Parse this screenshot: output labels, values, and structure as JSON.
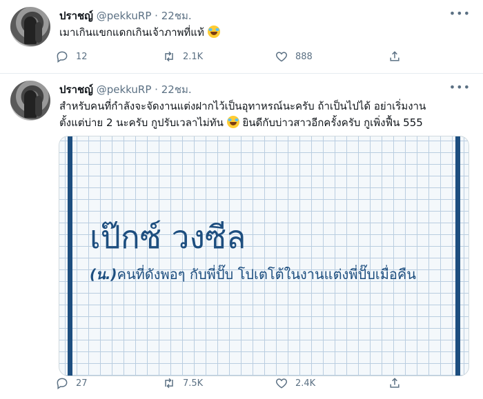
{
  "tweets": [
    {
      "name": "ปราชญ์",
      "handle": "@pekkuRP",
      "separator": "·",
      "time": "22ชม.",
      "text": "เมาเกินแขกแดกเกินเจ้าภาพที่แท้",
      "emoji": "face-with-tears-of-joy",
      "replies": "12",
      "retweets": "2.1K",
      "likes": "888"
    },
    {
      "name": "ปราชญ์",
      "handle": "@pekkuRP",
      "separator": "·",
      "time": "22ชม.",
      "text_line1": "สำหรับคนที่กำลังจะจัดงานแต่งฝากไว้เป็นอุทาหรณ์นะครับ ถ้าเป็นไปได้ อย่าเริ่มงาน",
      "text_line2a": "ตั้งแต่บ่าย 2 นะครับ กูปรับเวลาไม่ทัน",
      "text_line2b": " ยินดีกับบ่าวสาวอีกครั้งครับ กูเพิ่งฟื้น 555",
      "emoji": "face-with-tears-of-joy",
      "card": {
        "word": "เป๊กซ์ วงซีล",
        "pos": "(น.)",
        "definition": "คนที่ดังพอๆ กับพี่ปั๊บ โปเตโต้ในงานแต่งพี่ปั๊บเมื่อคืน"
      },
      "replies": "27",
      "retweets": "7.5K",
      "likes": "2.4K"
    }
  ],
  "icons": {
    "reply": "reply-icon",
    "retweet": "retweet-icon",
    "like": "heart-icon",
    "share": "share-icon",
    "more": "more-icon"
  },
  "colors": {
    "accent_card": "#1d4e7f",
    "meta_gray": "#5b7083"
  }
}
